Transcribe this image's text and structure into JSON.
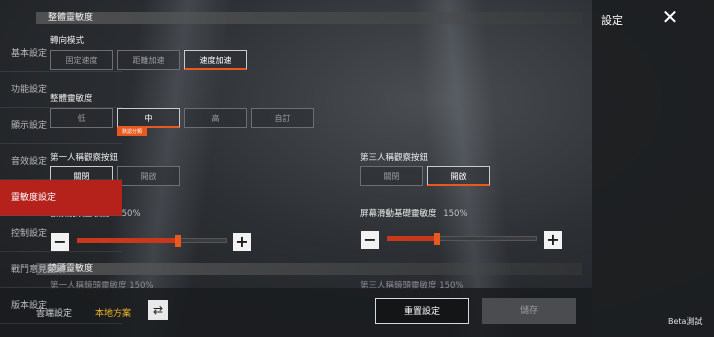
{
  "sidebar": {
    "title": "設定",
    "items": [
      {
        "label": "基本設定"
      },
      {
        "label": "功能設定"
      },
      {
        "label": "顯示設定"
      },
      {
        "label": "音效設定"
      },
      {
        "label": "靈敏度設定"
      },
      {
        "label": "控制設定"
      },
      {
        "label": "戰鬥意見回饋"
      },
      {
        "label": "版本設定"
      }
    ],
    "active_index": 4
  },
  "sections": {
    "overall": "整體靈敏度",
    "scope": "鏡頭靈敏度"
  },
  "turn_mode": {
    "label": "轉向模式",
    "options": [
      "固定速度",
      "距離加速",
      "速度加速"
    ],
    "selected": "速度加速"
  },
  "overall_sensitivity": {
    "label": "整體靈敏度",
    "options": [
      "低",
      "中",
      "高",
      "自訂"
    ],
    "selected": "中",
    "default_badge": "默認分類"
  },
  "fpp_watch": {
    "label": "第一人稱觀察按鈕",
    "options": [
      "關閉",
      "開啟"
    ],
    "selected": "關閉"
  },
  "tpp_watch": {
    "label": "第三人稱觀察按鈕",
    "options": [
      "關閉",
      "開啟"
    ],
    "selected": "開啟"
  },
  "camera_sens": {
    "label": "觀察鏡頭靈敏度",
    "value": "250%",
    "fraction": 0.67
  },
  "screen_sens": {
    "label": "屏幕滑動基礎靈敏度",
    "value": "150%",
    "fraction": 0.33
  },
  "partial_row": {
    "left": "第一人稱鏡頭靈敏度 150%",
    "right": "第三人稱鏡頭靈敏度 150%"
  },
  "bottom": {
    "cloud_label": "雲端設定",
    "local_label": "本地方案",
    "reset_label": "重置設定",
    "save_label": "儲存",
    "beta_label": "Beta測試"
  },
  "colors": {
    "accent": "#e8591f",
    "active_sidebar": "#b5211b"
  }
}
